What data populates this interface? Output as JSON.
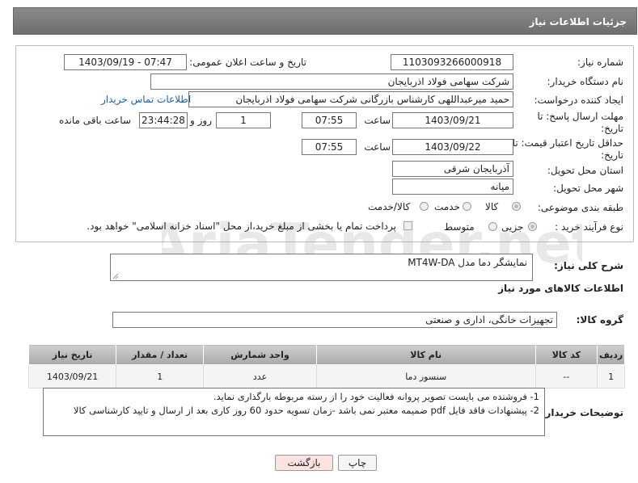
{
  "header": {
    "title": "جزئیات اطلاعات نیاز"
  },
  "form": {
    "need_number_label": "شماره نیاز:",
    "need_number": "1103093266000918",
    "announce_label": "تاریخ و ساعت اعلان عمومی:",
    "announce_value": "1403/09/19 - 07:47",
    "buyer_org_label": "نام دستگاه خریدار:",
    "buyer_org": "شرکت سهامی فولاد اذربایجان",
    "creator_label": "ایجاد کننده درخواست:",
    "creator": "حمید میرعبداللهی کارشناس بازرگانی شرکت سهامی فولاد اذربایجان",
    "contact_link": "اطلاعات تماس خریدار",
    "deadline_label_1": "مهلت ارسال پاسخ: تا",
    "deadline_label_2": "تاریخ:",
    "deadline_date": "1403/09/21",
    "time_label": "ساعت",
    "deadline_time": "07:55",
    "days_value": "1",
    "days_label": "روز و",
    "remaining_time": "23:44:28",
    "remaining_label": "ساعت باقی مانده",
    "validity_label_1": "حداقل تاریخ اعتبار قیمت: تا",
    "validity_label_2": "تاریخ:",
    "validity_date": "1403/09/22",
    "validity_time": "07:55",
    "province_label": "استان محل تحویل:",
    "province": "آذربایجان شرقی",
    "city_label": "شهر محل تحویل:",
    "city": "میانه",
    "category_label": "طبقه بندی موضوعی:",
    "category_options": [
      "کالا",
      "خدمت",
      "کالا/خدمت"
    ],
    "process_label": "نوع فرآیند خرید :",
    "process_options": [
      "جزیی",
      "متوسط"
    ],
    "payment_note": "پرداخت تمام یا بخشی از مبلغ خرید،از محل \"اسناد خزانه اسلامی\" خواهد بود."
  },
  "description": {
    "label": "شرح کلی نیاز:",
    "value": "نمایشگر دما مدل MT4W-DA"
  },
  "goods_section_title": "اطلاعات کالاهای مورد نیاز",
  "goods_group": {
    "label": "گروه کالا:",
    "value": "تجهیزات خانگی، اداری و صنعتی"
  },
  "table": {
    "headers": [
      "ردیف",
      "کد کالا",
      "نام کالا",
      "واحد شمارش",
      "تعداد / مقدار",
      "تاریخ نیاز"
    ],
    "rows": [
      [
        "1",
        "--",
        "سنسور دما",
        "عدد",
        "1",
        "1403/09/21"
      ]
    ]
  },
  "notes": {
    "label": "توضیحات خریدار:",
    "line1": "1- فروشنده می بایست تصویر پروانه فعالیت خود را از رسته مربوطه بارگذاری نماید.",
    "line2": "2- پیشنهادات فاقد فایل pdf  ضمیمه معتبر نمی باشد -زمان تسویه حدود 60  روز کاری بعد از ارسال و تایید کارشناسی کالا"
  },
  "buttons": {
    "print": "چاپ",
    "back": "بازگشت"
  },
  "watermark_text": "AriaTender.net",
  "colors": {
    "header_bg": "#7c7c7c",
    "link": "#1a5fb4",
    "back_btn_bg": "#fde2e2"
  }
}
